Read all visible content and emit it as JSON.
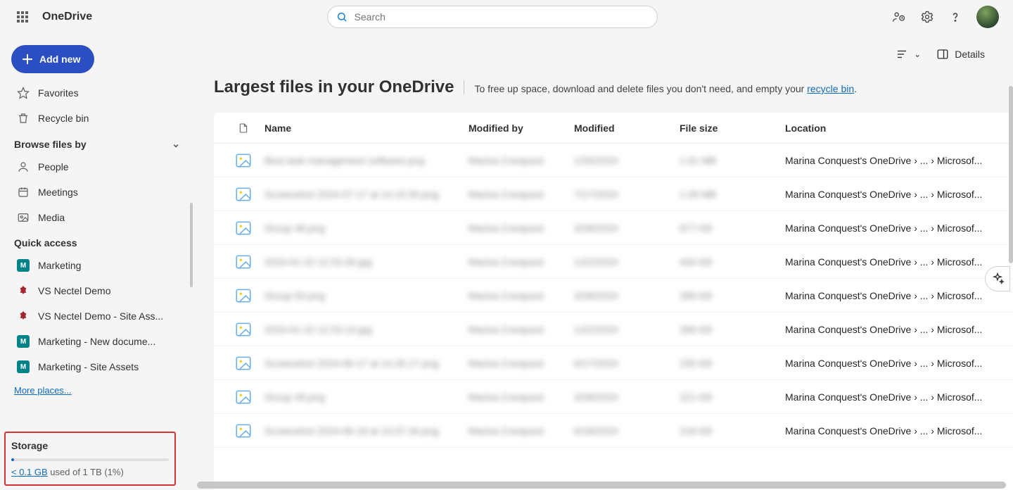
{
  "header": {
    "app_name": "OneDrive",
    "search_placeholder": "Search"
  },
  "sidebar": {
    "add_label": "Add new",
    "nav": [
      {
        "icon": "star",
        "label": "Favorites"
      },
      {
        "icon": "trash",
        "label": "Recycle bin"
      }
    ],
    "browse_header": "Browse files by",
    "browse": [
      {
        "icon": "person",
        "label": "People"
      },
      {
        "icon": "calendar",
        "label": "Meetings"
      },
      {
        "icon": "media",
        "label": "Media"
      }
    ],
    "quick_header": "Quick access",
    "quick": [
      {
        "badge": "M",
        "color": "teal",
        "label": "Marketing"
      },
      {
        "badge": "vs",
        "color": "red",
        "label": "VS Nectel Demo"
      },
      {
        "badge": "vs",
        "color": "red",
        "label": "VS Nectel Demo - Site Ass..."
      },
      {
        "badge": "M",
        "color": "teal",
        "label": "Marketing - New docume..."
      },
      {
        "badge": "M",
        "color": "teal",
        "label": "Marketing - Site Assets"
      }
    ],
    "more_places": "More places...",
    "storage": {
      "title": "Storage",
      "used_link": "< 0.1 GB",
      "used_rest": " used of 1 TB (1%)"
    }
  },
  "toolbar": {
    "details": "Details"
  },
  "page": {
    "title": "Largest files in your OneDrive",
    "subtitle_pre": "To free up space, download and delete files you don't need, and empty your ",
    "subtitle_link": "recycle bin",
    "subtitle_post": "."
  },
  "columns": {
    "name": "Name",
    "modified_by": "Modified by",
    "modified": "Modified",
    "size": "File size",
    "location": "Location"
  },
  "rows": [
    {
      "name": "Best task management software.png",
      "by": "Marina Conquest",
      "mod": "1/25/2024",
      "size": "1.91 MB",
      "loc": "Marina Conquest's OneDrive › ... › Microsof..."
    },
    {
      "name": "Screenshot 2024-07-17 at 14.15.50.png",
      "by": "Marina Conquest",
      "mod": "7/17/2024",
      "size": "1.09 MB",
      "loc": "Marina Conquest's OneDrive › ... › Microsof..."
    },
    {
      "name": "Group 46.png",
      "by": "Marina Conquest",
      "mod": "3/28/2024",
      "size": "677 KB",
      "loc": "Marina Conquest's OneDrive › ... › Microsof..."
    },
    {
      "name": "2024-01-22 12.53.30.jpg",
      "by": "Marina Conquest",
      "mod": "1/22/2024",
      "size": "434 KB",
      "loc": "Marina Conquest's OneDrive › ... › Microsof..."
    },
    {
      "name": "Group 50.png",
      "by": "Marina Conquest",
      "mod": "3/28/2024",
      "size": "289 KB",
      "loc": "Marina Conquest's OneDrive › ... › Microsof..."
    },
    {
      "name": "2024-01-22 12.53.10.jpg",
      "by": "Marina Conquest",
      "mod": "1/22/2024",
      "size": "266 KB",
      "loc": "Marina Conquest's OneDrive › ... › Microsof..."
    },
    {
      "name": "Screenshot 2024-06-17 at 14.26.17.png",
      "by": "Marina Conquest",
      "mod": "6/17/2024",
      "size": "235 KB",
      "loc": "Marina Conquest's OneDrive › ... › Microsof..."
    },
    {
      "name": "Group 49.png",
      "by": "Marina Conquest",
      "mod": "3/28/2024",
      "size": "221 KB",
      "loc": "Marina Conquest's OneDrive › ... › Microsof..."
    },
    {
      "name": "Screenshot 2024-06-18 at 10.07.34.png",
      "by": "Marina Conquest",
      "mod": "6/18/2024",
      "size": "218 KB",
      "loc": "Marina Conquest's OneDrive › ... › Microsof..."
    }
  ]
}
